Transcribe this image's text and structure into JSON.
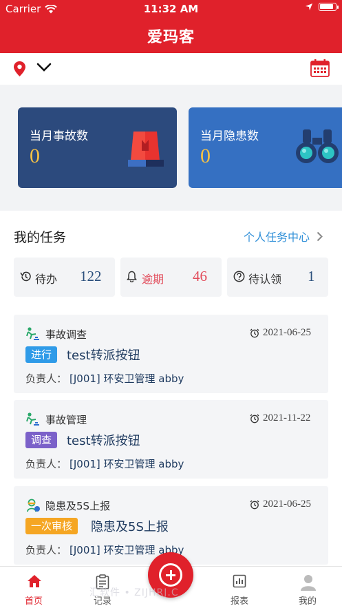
{
  "status_bar": {
    "carrier": "Carrier",
    "time": "11:32 AM",
    "battery_percent": 90
  },
  "header": {
    "title": "爱玛客"
  },
  "toolbar": {
    "location_icon": "location-pin-icon",
    "dropdown_icon": "chevron-down-icon",
    "calendar_icon": "calendar-icon"
  },
  "stats": {
    "accidents": {
      "label": "当月事故数",
      "value": "0",
      "icon": "siren-icon"
    },
    "hazards": {
      "label": "当月隐患数",
      "value": "0",
      "icon": "binoculars-icon"
    }
  },
  "tasks": {
    "title": "我的任务",
    "center_link": "个人任务中心",
    "counters": [
      {
        "label": "待办",
        "count": "122",
        "icon": "history-icon"
      },
      {
        "label": "逾期",
        "count": "46",
        "icon": "bell-icon"
      },
      {
        "label": "待认领",
        "count": "1",
        "icon": "question-icon"
      }
    ],
    "items": [
      {
        "type": "事故调查",
        "date": "2021-06-25",
        "status": "进行",
        "status_color": "#2f9be8",
        "name": "test转派按钮",
        "owner_label": "负责人：",
        "owner": "[J001] 环安卫管理 abby"
      },
      {
        "type": "事故管理",
        "date": "2021-11-22",
        "status": "调查",
        "status_color": "#7b61c9",
        "name": "test转派按钮",
        "owner_label": "负责人：",
        "owner": "[J001] 环安卫管理 abby"
      },
      {
        "type": "隐患及5S上报",
        "date": "2021-06-25",
        "status": "一次审核",
        "status_color": "#f5a623",
        "name": "隐患及5S上报",
        "owner_label": "负责人：",
        "owner": "[J001] 环安卫管理 abby"
      }
    ]
  },
  "tabbar": {
    "tabs": [
      {
        "label": "首页",
        "icon": "home-icon"
      },
      {
        "label": "记录",
        "icon": "clipboard-icon"
      },
      {
        "label": "报表",
        "icon": "report-icon"
      },
      {
        "label": "我的",
        "icon": "user-icon"
      }
    ],
    "fab_icon": "add-icon"
  },
  "watermark": "汇软件 • ZIJHRJ.C"
}
